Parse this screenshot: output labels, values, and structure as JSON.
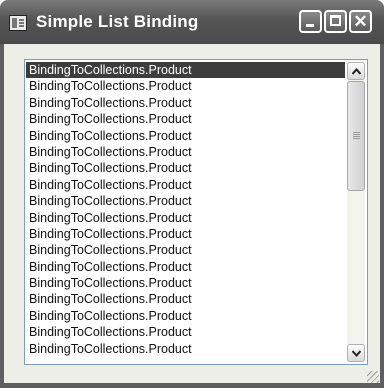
{
  "window": {
    "title": "Simple List Binding",
    "icon": "app-form-icon",
    "controls": [
      "minimize-icon",
      "maximize-icon",
      "close-icon"
    ],
    "close_glyph": "✕"
  },
  "listbox": {
    "items": [
      "BindingToCollections.Product",
      "BindingToCollections.Product",
      "BindingToCollections.Product",
      "BindingToCollections.Product",
      "BindingToCollections.Product",
      "BindingToCollections.Product",
      "BindingToCollections.Product",
      "BindingToCollections.Product",
      "BindingToCollections.Product",
      "BindingToCollections.Product",
      "BindingToCollections.Product",
      "BindingToCollections.Product",
      "BindingToCollections.Product",
      "BindingToCollections.Product",
      "BindingToCollections.Product",
      "BindingToCollections.Product",
      "BindingToCollections.Product",
      "BindingToCollections.Product"
    ],
    "selected_index": 0
  },
  "colors": {
    "titlebar": "#555555",
    "selection": "#3d3d3d",
    "list_border": "#7f9db9"
  }
}
